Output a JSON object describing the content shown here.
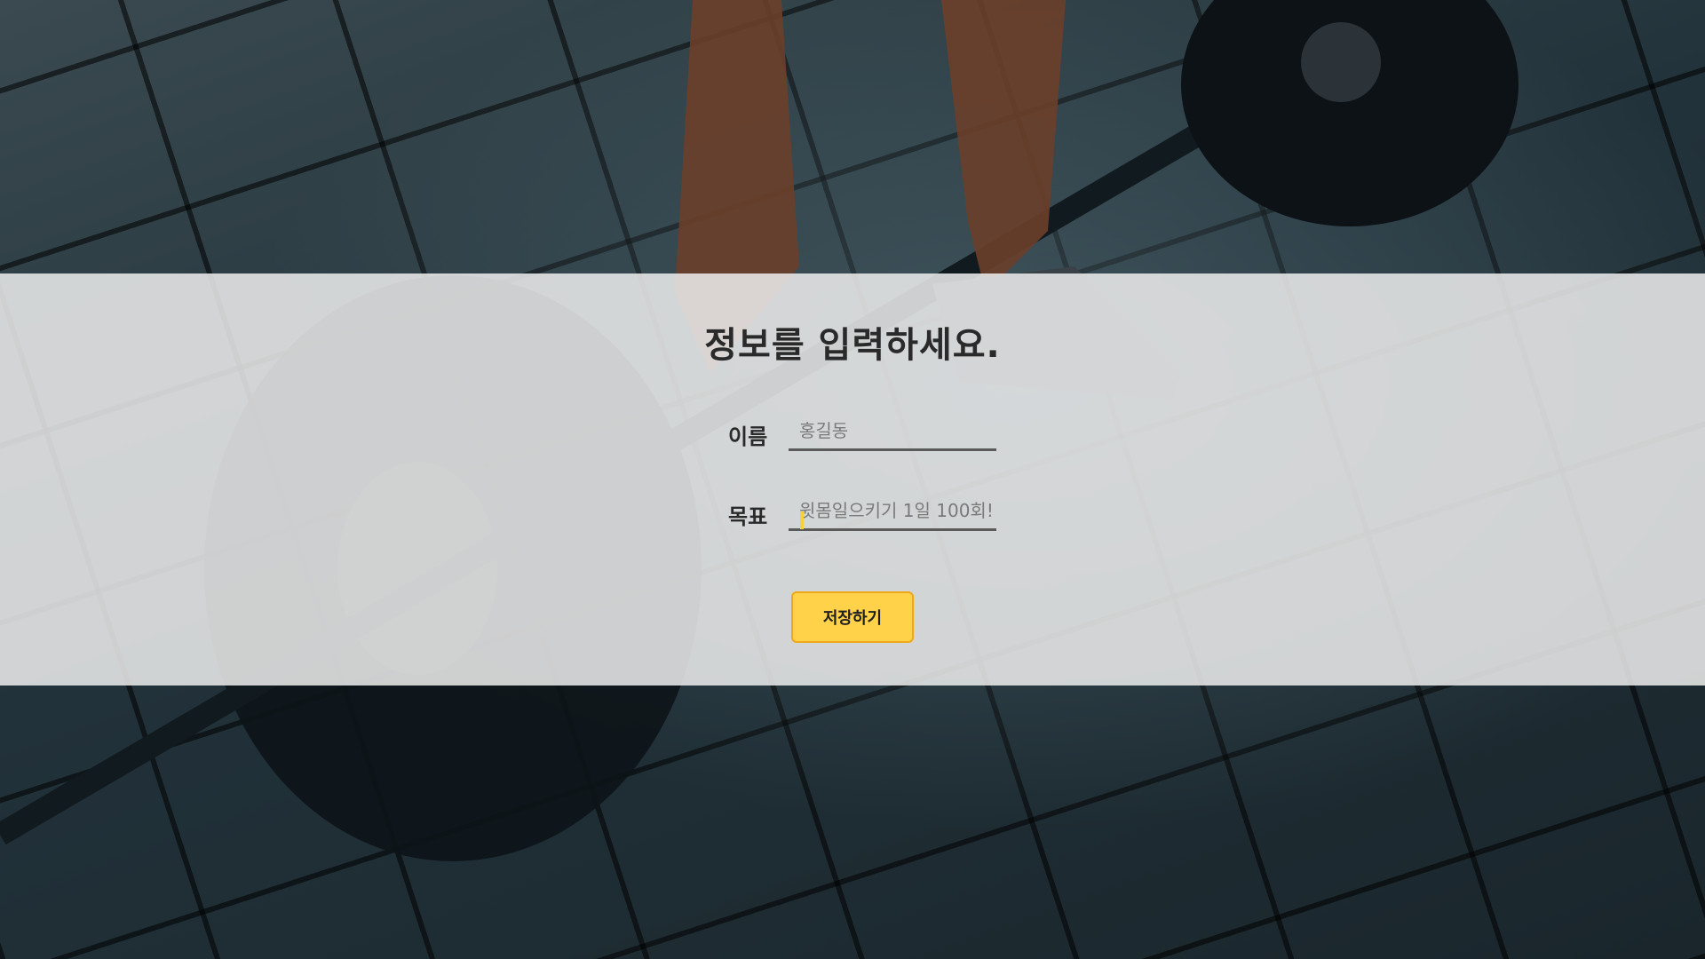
{
  "form": {
    "title": "정보를 입력하세요.",
    "name_label": "이름",
    "name_placeholder": "홍길동",
    "goal_label": "목표",
    "goal_placeholder": "윗몸일으키기 1일 100회!",
    "save_label": "저장하기"
  },
  "colors": {
    "button_fill": "#ffd24a",
    "button_border": "#f0a818",
    "panel_overlay": "#eeeeee"
  }
}
